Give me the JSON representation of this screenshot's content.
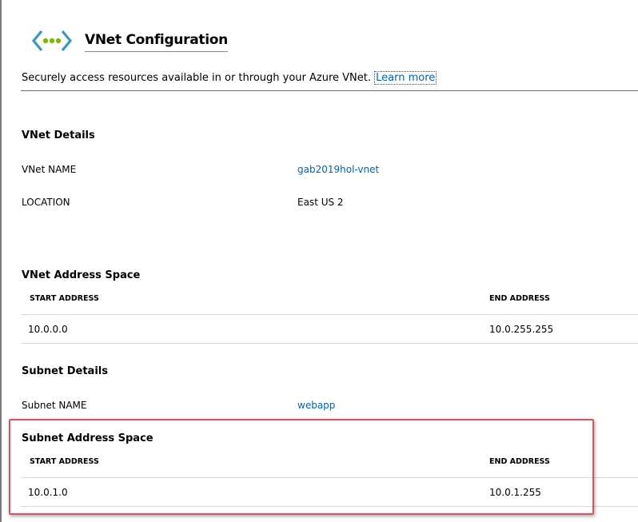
{
  "header": {
    "title": "VNet Configuration",
    "description": "Securely access resources available in or through your Azure VNet.",
    "learn_more": "Learn more"
  },
  "vnet_details": {
    "heading": "VNet Details",
    "name_label": "VNet NAME",
    "name_value": "gab2019hol-vnet",
    "location_label": "LOCATION",
    "location_value": "East US 2"
  },
  "vnet_address_space": {
    "heading": "VNet Address Space",
    "columns": [
      "START ADDRESS",
      "END ADDRESS"
    ],
    "rows": [
      [
        "10.0.0.0",
        "10.0.255.255"
      ]
    ]
  },
  "subnet_details": {
    "heading": "Subnet Details",
    "name_label": "Subnet NAME",
    "name_value": "webapp"
  },
  "subnet_address_space": {
    "heading": "Subnet Address Space",
    "columns": [
      "START ADDRESS",
      "END ADDRESS"
    ],
    "rows": [
      [
        "10.0.1.0",
        "10.0.1.255"
      ]
    ]
  },
  "colors": {
    "link": "#0063b1",
    "icon_bracket": "#3999c6",
    "icon_dot": "#7fba00",
    "highlight": "#e0515e"
  },
  "icons": {
    "header": "vnet-icon"
  }
}
